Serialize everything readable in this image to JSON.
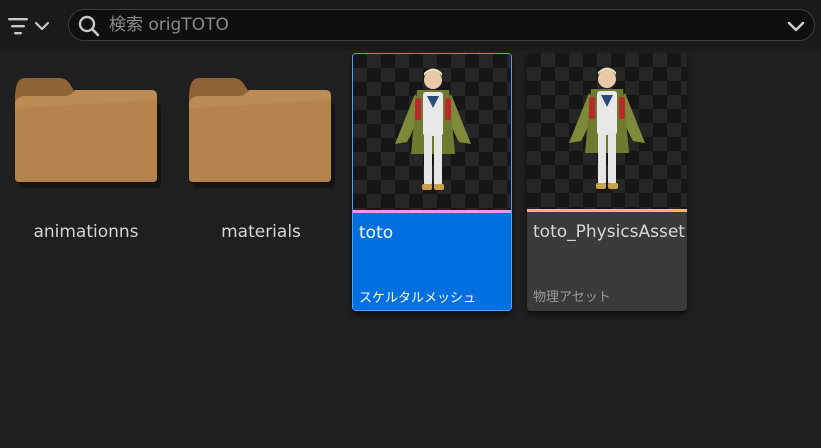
{
  "search": {
    "placeholder": "検索 origTOTO"
  },
  "icons": {
    "filter": "filter-lines-icon",
    "dropdown": "chevron-down-icon",
    "search": "magnifier-icon",
    "folder": "folder-icon"
  },
  "colors": {
    "folder": "#b5844c",
    "folder_dark": "#8f6336",
    "selected_card": "#0070e0",
    "card_body": "#3a3a3a",
    "skeletal_mesh_strip": "#e39cf0",
    "physics_asset_strip": "#f5b56b"
  },
  "folders": [
    {
      "label": "animationns"
    },
    {
      "label": "materials"
    }
  ],
  "assets": [
    {
      "name": "toto",
      "type": "スケルタルメッシュ",
      "selected": true
    },
    {
      "name": "toto_PhysicsAsset",
      "type": "物理アセット",
      "selected": false
    }
  ]
}
